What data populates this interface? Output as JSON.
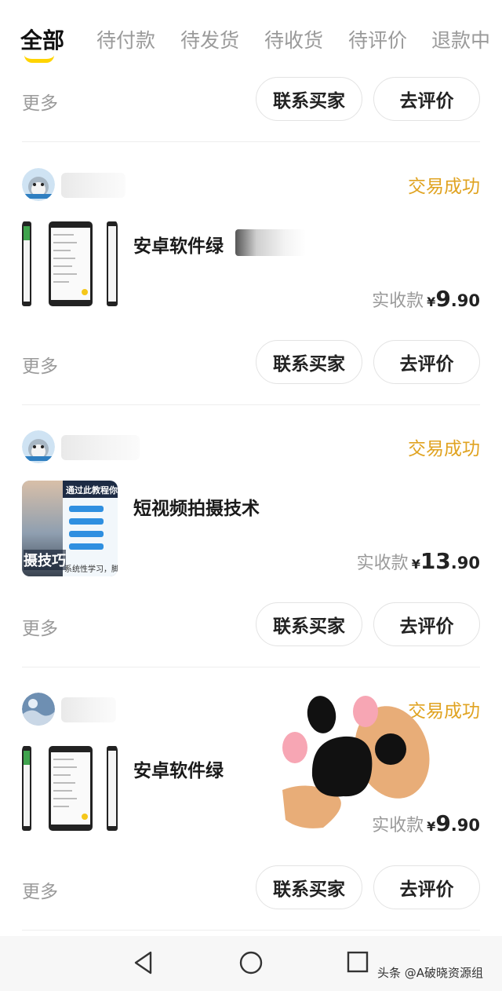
{
  "tabs": [
    {
      "label": "全部"
    },
    {
      "label": "待付款"
    },
    {
      "label": "待发货"
    },
    {
      "label": "待收货"
    },
    {
      "label": "待评价"
    },
    {
      "label": "退款中"
    }
  ],
  "actions": {
    "more": "更多",
    "contact": "联系买家",
    "review": "去评价"
  },
  "orders": [
    {
      "status": "交易成功",
      "title": "安卓软件绿",
      "price_label": "实收款",
      "currency": "¥",
      "price_int": "9",
      "price_dec": ".90"
    },
    {
      "status": "交易成功",
      "title": "短视频拍摄技术",
      "price_label": "实收款",
      "currency": "¥",
      "price_int": "13",
      "price_dec": ".90",
      "thumb_text": {
        "top": "通过此教程你",
        "big": "摄技巧",
        "bottom": "系统性学习，脚"
      }
    },
    {
      "status": "交易成功",
      "title": "安卓软件绿",
      "price_label": "实收款",
      "currency": "¥",
      "price_int": "9",
      "price_dec": ".90"
    }
  ],
  "watermark": "头条 @A破晓资源组",
  "colors": {
    "accent_yellow": "#ffd400",
    "status_orange": "#e0a321",
    "muted_text": "#9a9a9a"
  },
  "icons": [
    "back-icon",
    "home-icon",
    "recent-apps-icon",
    "paw-sticker"
  ]
}
